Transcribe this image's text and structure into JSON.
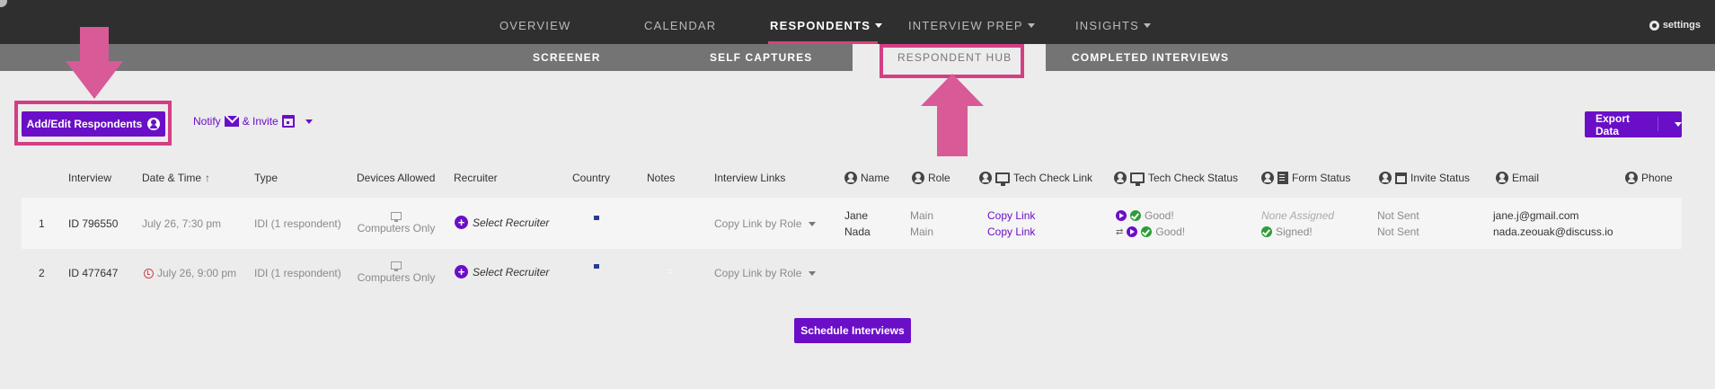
{
  "nav": {
    "overview": "OVERVIEW",
    "calendar": "CALENDAR",
    "respondents": "RESPONDENTS",
    "interview_prep": "INTERVIEW PREP",
    "insights": "INSIGHTS",
    "settings": "settings"
  },
  "subnav": {
    "screener": "SCREENER",
    "self_captures": "SELF CAPTURES",
    "respondent_hub": "RESPONDENT HUB",
    "completed": "COMPLETED INTERVIEWS"
  },
  "toolbar": {
    "add_edit": "Add/Edit Respondents",
    "notify": "Notify",
    "invite": "& Invite",
    "export": "Export Data"
  },
  "columns": {
    "interview": "Interview",
    "datetime": "Date & Time",
    "type": "Type",
    "devices": "Devices Allowed",
    "recruiter": "Recruiter",
    "country": "Country",
    "notes": "Notes",
    "links": "Interview Links",
    "name": "Name",
    "role": "Role",
    "tech_link": "Tech Check Link",
    "tech_status": "Tech Check Status",
    "form_status": "Form Status",
    "invite_status": "Invite Status",
    "email": "Email",
    "phone": "Phone"
  },
  "rows": [
    {
      "num": "1",
      "id": "ID 796550",
      "datetime": "July 26, 7:30 pm",
      "type": "IDI (1 respondent)",
      "devices": "Computers Only",
      "recruiter": "Select Recruiter",
      "links": "Copy Link by Role",
      "respondents": [
        {
          "name": "Jane",
          "role": "Main",
          "tech_link": "Copy Link",
          "tech_status": "Good!",
          "form_status": "None Assigned",
          "invite_status": "Not Sent",
          "email": "jane.j@gmail.com"
        },
        {
          "name": "Nada",
          "role": "Main",
          "tech_link": "Copy Link",
          "tech_status": "Good!",
          "form_status": "Signed!",
          "invite_status": "Not Sent",
          "email": "nada.zeouak@discuss.io"
        }
      ]
    },
    {
      "num": "2",
      "id": "ID 477647",
      "datetime": "July 26, 9:00 pm",
      "type": "IDI (1 respondent)",
      "devices": "Computers Only",
      "recruiter": "Select Recruiter",
      "links": "Copy Link by Role"
    }
  ],
  "schedule": "Schedule Interviews",
  "colors": {
    "accent": "#6a0fc7",
    "annotation": "#d23f84",
    "topbar": "#2f2f2f",
    "subbar": "#747474"
  }
}
